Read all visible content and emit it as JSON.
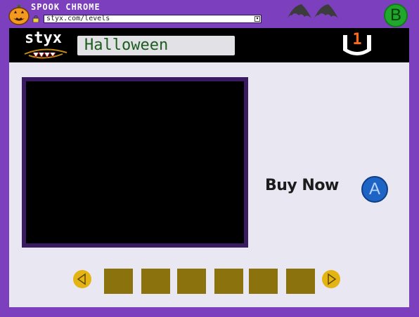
{
  "browser": {
    "title": "SPOOK CHROME",
    "url": "styx.com/levels",
    "b_button_label": "B",
    "pumpkin_icon": "jack-o-lantern-icon",
    "lock_icon": "lock-icon",
    "bats_icon": "bat-wings-icon"
  },
  "header": {
    "logo_text": "styx",
    "level_name": "Halloween",
    "count": "1",
    "count_icon": "bucket-icon"
  },
  "main": {
    "buy_label": "Buy Now",
    "a_button_label": "A",
    "prev_icon": "triangle-left-icon",
    "next_icon": "triangle-right-icon",
    "thumbnail_count": 6
  },
  "colors": {
    "frame_purple": "#7c3fbd",
    "window_bg": "#e9e7f1",
    "level_text_green": "#1b5d1d",
    "count_orange": "#ff6a1a",
    "b_button_green": "#1fa82b",
    "a_button_blue": "#1d64c4",
    "arrow_gold": "#e4b414",
    "thumb_olive": "#8c720d"
  }
}
